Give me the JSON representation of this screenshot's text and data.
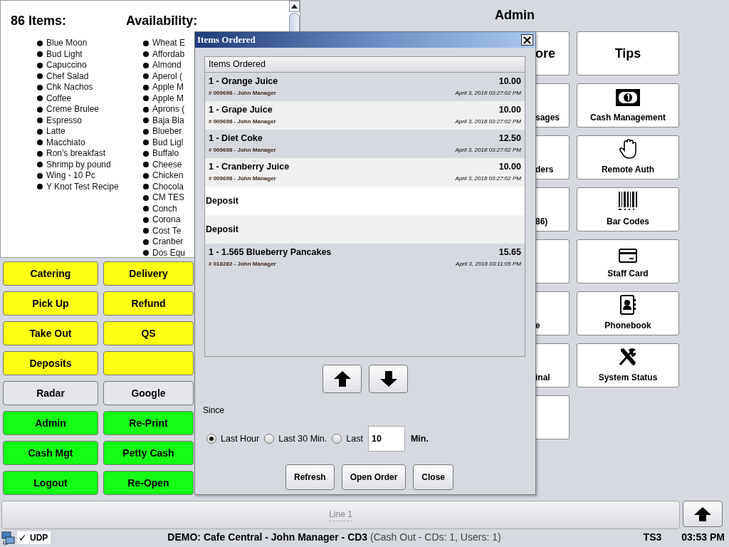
{
  "left_panel": {
    "items_heading": "86 Items:",
    "availability_heading": "Availability:",
    "items": [
      "Blue Moon",
      "Bud Light",
      "Capuccino",
      "Chef Salad",
      "Chk Nachos",
      "Coffee",
      "Creme Brulee",
      "Espresso",
      "Latte",
      "Macchiato",
      "Ron's breakfast",
      "Shrimp by pound",
      "Wing - 10 Pc",
      "Y Knot Test Recipe"
    ],
    "availability": [
      "Wheat E",
      "Affordab",
      "Almond",
      "Aperol (",
      "Apple M",
      "Apple M",
      "Aprons (",
      "Baja Bla",
      "Blueber",
      "Bud Ligl",
      "Buffalo",
      "Cheese",
      "Chicken",
      "Chocola",
      "CM TES",
      "Conch",
      "Corona",
      "Cost Te",
      "Cranber",
      "Dos Equ"
    ]
  },
  "left_buttons": [
    {
      "label": "Catering",
      "color": "#ffff14"
    },
    {
      "label": "Delivery",
      "color": "#ffff14"
    },
    {
      "label": "Pick Up",
      "color": "#ffff14"
    },
    {
      "label": "Refund",
      "color": "#ffff14"
    },
    {
      "label": "Take Out",
      "color": "#ffff14"
    },
    {
      "label": "QS",
      "color": "#ffff14"
    },
    {
      "label": "Deposits",
      "color": "#ffff14"
    },
    {
      "color": "#ffff14"
    },
    {
      "label": "Radar",
      "color": "#e4e6ea"
    },
    {
      "label": "Google",
      "color": "#e4e6ea"
    },
    {
      "label": "Admin",
      "color": "#14ff14"
    },
    {
      "label": "Re-Print",
      "color": "#14ff14"
    },
    {
      "label": "Cash Mgt",
      "color": "#14ff14"
    },
    {
      "label": "Petty Cash",
      "color": "#14ff14"
    },
    {
      "label": "Logout",
      "color": "#14ff14"
    },
    {
      "label": "Re-Open",
      "color": "#14ff14"
    }
  ],
  "admin": {
    "title": "Admin",
    "column_1": [
      {
        "kind": "large",
        "label": "ore"
      },
      {
        "kind": "small",
        "label": "sages"
      },
      {
        "kind": "small",
        "label": "ders"
      },
      {
        "kind": "small",
        "label": "86)"
      },
      {
        "kind": "blank"
      },
      {
        "kind": "small",
        "label": "e"
      },
      {
        "kind": "small",
        "label": "inal"
      },
      {
        "kind": "blank"
      }
    ],
    "column_2": [
      {
        "kind": "large",
        "label": "Tips"
      },
      {
        "kind": "icon",
        "label": "Cash Management"
      },
      {
        "kind": "icon",
        "label": "Remote Auth"
      },
      {
        "kind": "icon",
        "label": "Bar Codes"
      },
      {
        "kind": "icon",
        "label": "Staff Card"
      },
      {
        "kind": "icon",
        "label": "Phonebook"
      },
      {
        "kind": "icon",
        "label": "System Status"
      }
    ]
  },
  "dialog": {
    "title": "Items Ordered",
    "list_header": "Items Ordered",
    "rows": [
      {
        "kind": "item",
        "name": "1 - Orange Juice",
        "price": "10.00",
        "detail": "# 009698 - John Manager",
        "time": "April 3, 2018 03:27:02 PM"
      },
      {
        "kind": "item",
        "name": "1 - Grape Juice",
        "price": "10.00",
        "detail": "# 009698 - John Manager",
        "time": "April 3, 2018 03:27:02 PM"
      },
      {
        "kind": "item",
        "name": "1 - Diet Coke",
        "price": "12.50",
        "detail": "# 009698 - John Manager",
        "time": "April 3, 2018 03:27:02 PM"
      },
      {
        "kind": "item",
        "name": "1 - Cranberry Juice",
        "price": "10.00",
        "detail": "# 009698 - John Manager",
        "time": "April 3, 2018 03:27:02 PM"
      },
      {
        "kind": "deposit",
        "name": "Deposit"
      },
      {
        "kind": "deposit",
        "name": "Deposit"
      },
      {
        "kind": "item",
        "name": "1 - 1.565 Blueberry Pancakes",
        "price": "15.65",
        "detail": "# 018282 - John Manager",
        "time": "April 3, 2018 03:11:05 PM"
      }
    ],
    "since_label": "Since",
    "options": [
      {
        "label": "Last Hour",
        "selected": true
      },
      {
        "label": "Last 30 Min.",
        "selected": false
      },
      {
        "label": "Last",
        "selected": false
      }
    ],
    "minutes_field": {
      "value": "10"
    },
    "minutes_unit": "Min.",
    "buttons": [
      "Refresh",
      "Open Order",
      "Close"
    ]
  },
  "line_bar": {
    "label": "Line 1"
  },
  "status_bar": {
    "check": "✓",
    "protocol": "UDP",
    "session": "**DEMO: Cafe Central - John Manager - CD3** (Cash Out - CDs: 1, Users: 1)",
    "terminal": "TS3",
    "time": "03:53 PM"
  }
}
